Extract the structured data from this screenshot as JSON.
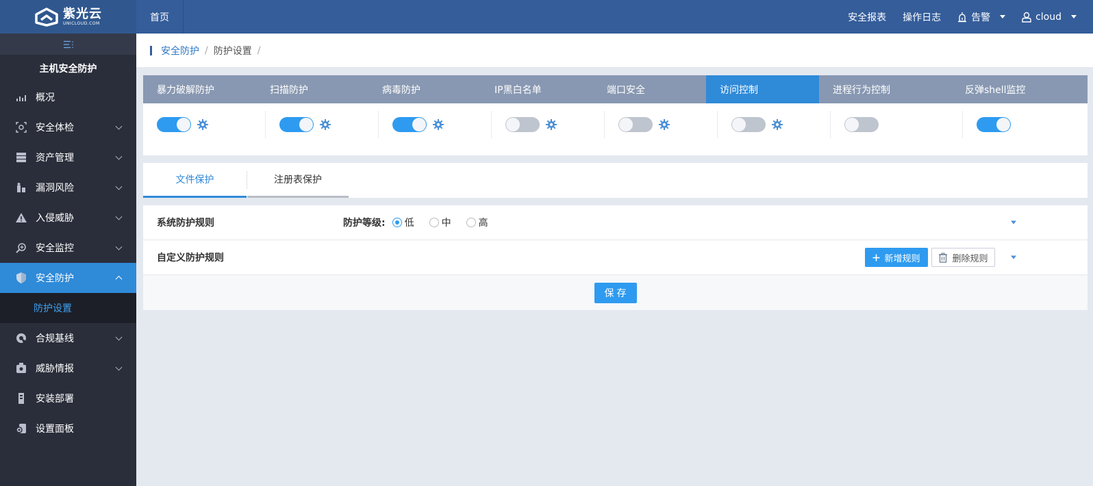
{
  "header": {
    "logo_cn": "紫光云",
    "logo_en": "UNICLOUD.COM",
    "home": "首页",
    "links": [
      "安全报表",
      "操作日志"
    ],
    "alert": "告警",
    "user": "cloud"
  },
  "sidebar": {
    "title": "主机安全防护",
    "items": [
      {
        "label": "概况",
        "icon": "bar-chart-icon",
        "expandable": false
      },
      {
        "label": "安全体检",
        "icon": "scan-icon",
        "expandable": true
      },
      {
        "label": "资产管理",
        "icon": "server-icon",
        "expandable": true
      },
      {
        "label": "漏洞风险",
        "icon": "bug-icon",
        "expandable": true
      },
      {
        "label": "入侵威胁",
        "icon": "warning-icon",
        "expandable": true
      },
      {
        "label": "安全监控",
        "icon": "monitor-search-icon",
        "expandable": true
      },
      {
        "label": "安全防护",
        "icon": "shield-icon",
        "expandable": true,
        "active": true
      }
    ],
    "sub_item": "防护设置",
    "items_after": [
      {
        "label": "合规基线",
        "icon": "baseline-icon",
        "expandable": true
      },
      {
        "label": "威胁情报",
        "icon": "intel-icon",
        "expandable": true
      },
      {
        "label": "安装部署",
        "icon": "install-icon",
        "expandable": false
      },
      {
        "label": "设置面板",
        "icon": "settings-panel-icon",
        "expandable": false
      }
    ]
  },
  "breadcrumb": {
    "parent": "安全防护",
    "current": "防护设置",
    "sep": "/"
  },
  "protection_tabs": [
    {
      "label": "暴力破解防护",
      "on": true,
      "gear": true
    },
    {
      "label": "扫描防护",
      "on": true,
      "gear": true
    },
    {
      "label": "病毒防护",
      "on": true,
      "gear": true
    },
    {
      "label": "IP黑白名单",
      "on": false,
      "gear": true
    },
    {
      "label": "端口安全",
      "on": false,
      "gear": true
    },
    {
      "label": "访问控制",
      "on": false,
      "gear": true,
      "active": true
    },
    {
      "label": "进程行为控制",
      "on": false,
      "gear": false
    },
    {
      "label": "反弹shell监控",
      "on": true,
      "gear": false
    }
  ],
  "sub_tabs": {
    "file": "文件保护",
    "registry": "注册表保护"
  },
  "rules": {
    "system_label": "系统防护规则",
    "level_label": "防护等级:",
    "levels": [
      "低",
      "中",
      "高"
    ],
    "selected_level": "低",
    "custom_label": "自定义防护规则",
    "add_button": "新增规则",
    "delete_button": "删除规则",
    "save_button": "保存"
  },
  "colors": {
    "topbar": "#345d9a",
    "sidebar": "#2a2e3a",
    "accent": "#2e9bf0",
    "tab_bar": "#8898b2"
  }
}
